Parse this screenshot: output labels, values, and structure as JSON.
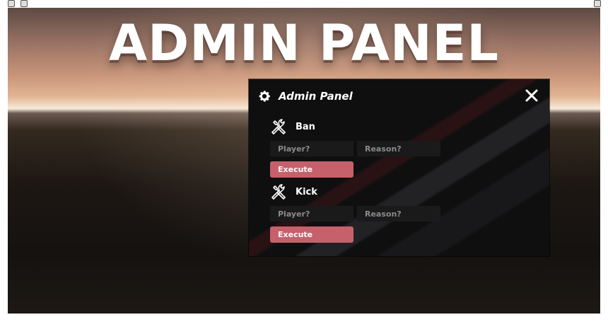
{
  "banner": {
    "title": "ADMIN PANEL"
  },
  "panel": {
    "title": "Admin Panel",
    "header_icon": "gear-icon",
    "close_icon": "close-icon",
    "sections": [
      {
        "title": "Ban",
        "icon": "tools-icon",
        "player_placeholder": "Player?",
        "reason_placeholder": "Reason?",
        "execute_label": "Execute"
      },
      {
        "title": "Kick",
        "icon": "tools-icon",
        "player_placeholder": "Player?",
        "reason_placeholder": "Reason?",
        "execute_label": "Execute"
      }
    ]
  },
  "colors": {
    "panel_bg": "#0f0f10",
    "field_bg": "#1a1a1b",
    "execute_button": "#c6606a",
    "text": "#ffffff",
    "placeholder": "#8a8a8a"
  }
}
